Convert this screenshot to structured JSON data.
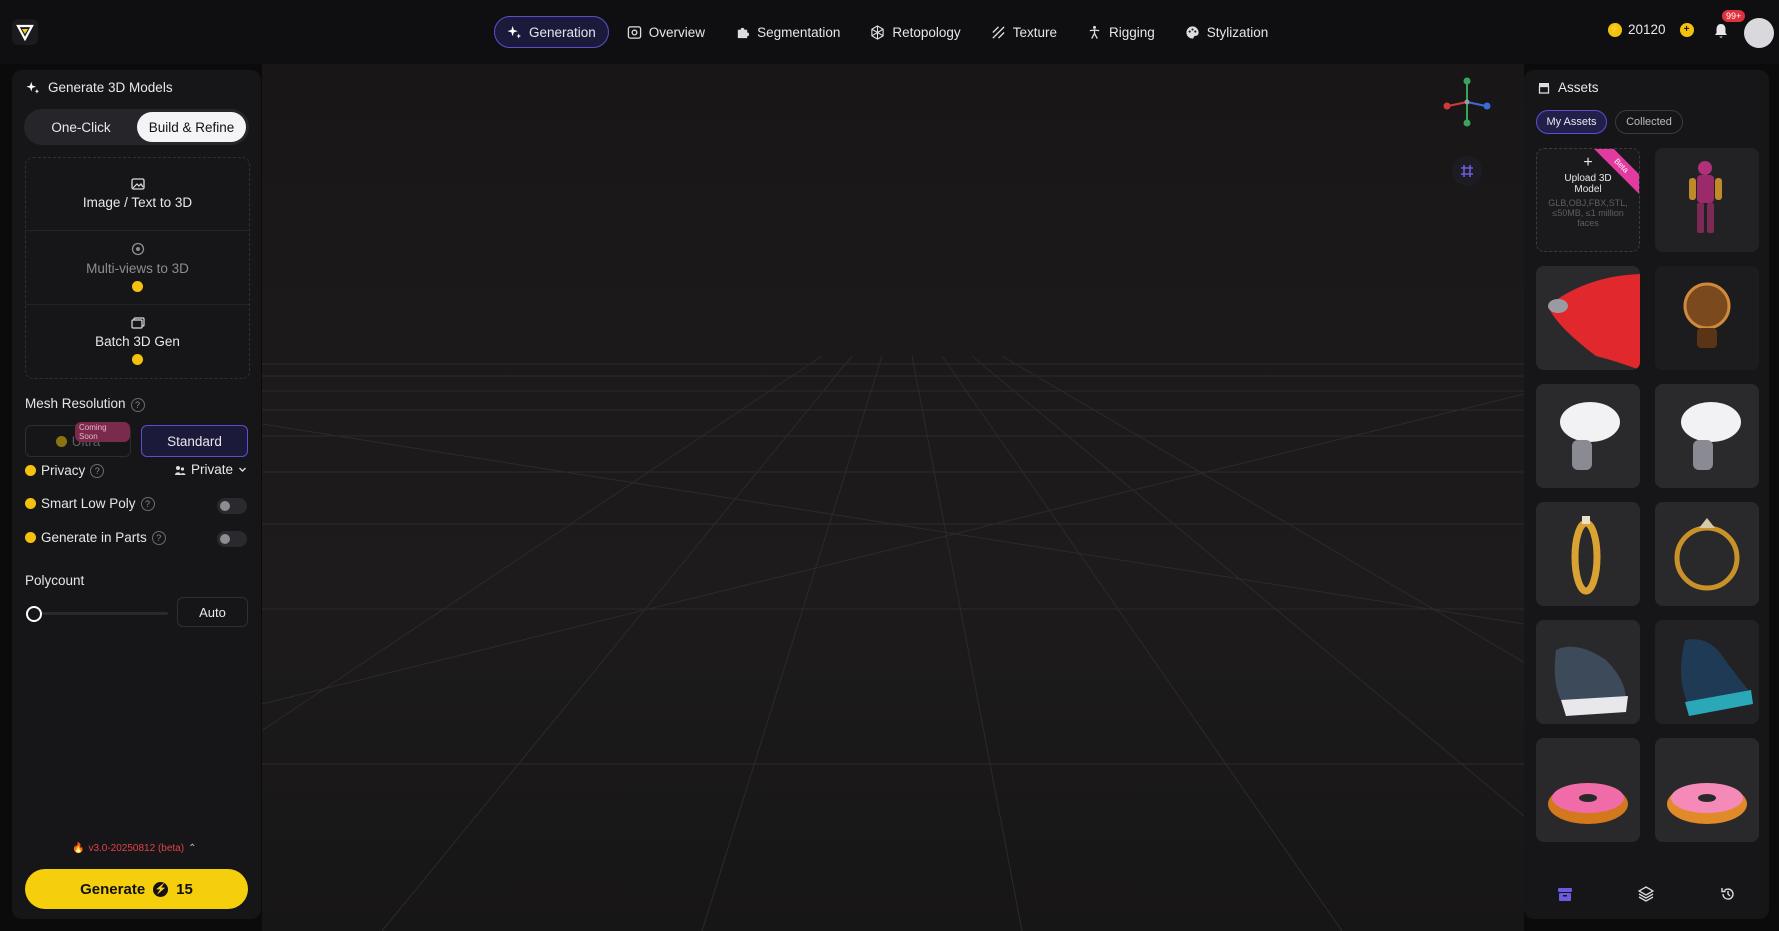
{
  "nav": {
    "items": [
      {
        "label": "Generation",
        "icon": "sparkle-icon",
        "active": true
      },
      {
        "label": "Overview",
        "icon": "overview-icon",
        "active": false
      },
      {
        "label": "Segmentation",
        "icon": "puzzle-icon",
        "active": false
      },
      {
        "label": "Retopology",
        "icon": "mesh-icon",
        "active": false
      },
      {
        "label": "Texture",
        "icon": "texture-icon",
        "active": false
      },
      {
        "label": "Rigging",
        "icon": "rigging-icon",
        "active": false
      },
      {
        "label": "Stylization",
        "icon": "palette-icon",
        "active": false
      }
    ],
    "credits": "20120",
    "notifications_badge": "99+"
  },
  "left_panel": {
    "title": "Generate 3D Models",
    "mode_tabs": [
      "One-Click",
      "Build & Refine"
    ],
    "active_mode": "Build & Refine",
    "gen_types": [
      {
        "label": "Image / Text to 3D",
        "icon": "image-edit-icon",
        "paid": false,
        "dim": false
      },
      {
        "label": "Multi-views to 3D",
        "icon": "multiview-icon",
        "paid": true,
        "dim": true
      },
      {
        "label": "Batch 3D Gen",
        "icon": "batch-icon",
        "paid": true,
        "dim": false
      }
    ],
    "mesh_resolution": {
      "label": "Mesh Resolution",
      "options": [
        "Ultra",
        "Standard"
      ],
      "coming_soon": "Coming Soon",
      "selected": "Standard"
    },
    "privacy": {
      "label": "Privacy",
      "value": "Private"
    },
    "smart_low_poly": {
      "label": "Smart Low Poly",
      "enabled": false
    },
    "generate_in_parts": {
      "label": "Generate in Parts",
      "enabled": false
    },
    "polycount": {
      "label": "Polycount",
      "value": "Auto",
      "slider_fraction": 0
    },
    "version": "v3.0-20250812 (beta)",
    "generate": {
      "label": "Generate",
      "cost": "15"
    }
  },
  "right_panel": {
    "title": "Assets",
    "tabs": [
      "My Assets",
      "Collected"
    ],
    "active_tab": "My Assets",
    "upload": {
      "label": "Upload 3D Model",
      "hint": "GLB,OBJ,FBX,STL, ≤50MB, ≤1 million faces",
      "ribbon": "Beta"
    },
    "assets": [
      {
        "name": "armored-warrior"
      },
      {
        "name": "red-shape"
      },
      {
        "name": "bronze-orb-ornament"
      },
      {
        "name": "white-airship-skull-1"
      },
      {
        "name": "white-airship-skull-2"
      },
      {
        "name": "gold-ring-side"
      },
      {
        "name": "gold-ring-diamond"
      },
      {
        "name": "sneaker-1"
      },
      {
        "name": "sneaker-2"
      },
      {
        "name": "donut-1"
      },
      {
        "name": "donut-2"
      }
    ]
  },
  "colors": {
    "accent": "#5b4fd0",
    "generate": "#f5cf0b",
    "coin": "#f4c20d",
    "badge": "#e0313f"
  }
}
